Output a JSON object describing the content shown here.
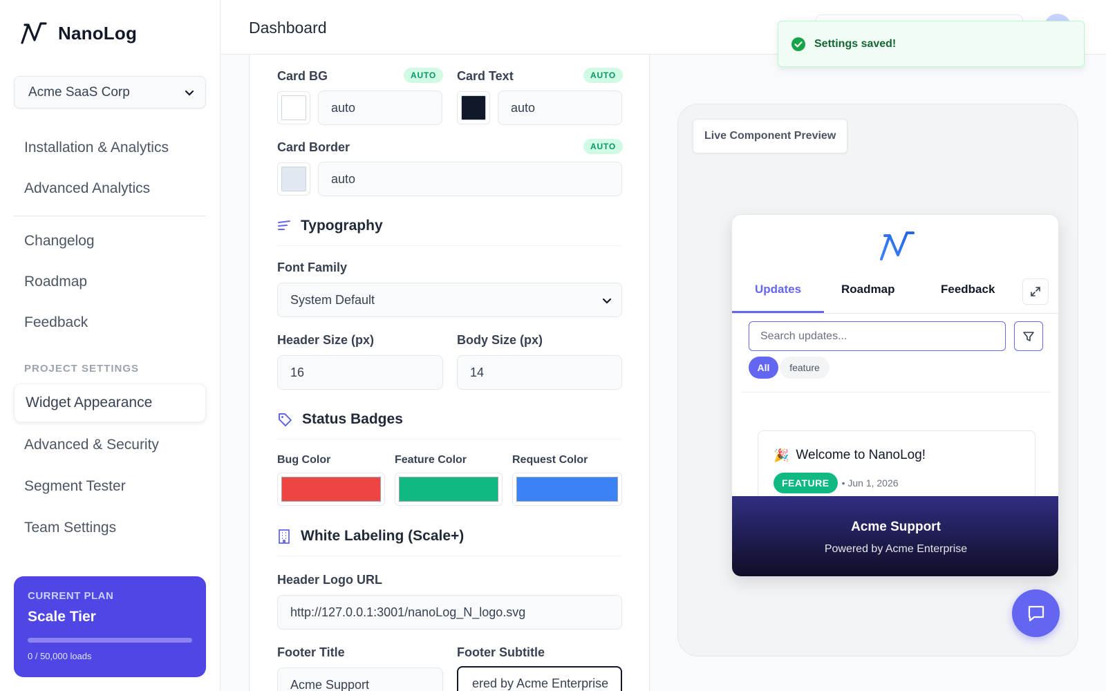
{
  "app": {
    "name": "NanoLog"
  },
  "sidebar": {
    "org": "Acme SaaS Corp",
    "items_top": [
      "Installation & Analytics",
      "Advanced Analytics"
    ],
    "items_content": [
      "Changelog",
      "Roadmap",
      "Feedback"
    ],
    "section_label": "PROJECT SETTINGS",
    "active_item": "Widget Appearance",
    "items_settings": [
      "Advanced & Security",
      "Segment Tester",
      "Team Settings"
    ],
    "plan": {
      "label": "CURRENT PLAN",
      "name": "Scale Tier",
      "usage": "0 / 50,000 loads",
      "usage_fraction": 0
    }
  },
  "header": {
    "title": "Dashboard"
  },
  "toast": {
    "text": "Settings saved!"
  },
  "colors": {
    "card_bg": {
      "label": "Card BG",
      "badge": "AUTO",
      "value": "auto",
      "swatch": "#ffffff"
    },
    "card_text": {
      "label": "Card Text",
      "badge": "AUTO",
      "value": "auto",
      "swatch": "#111827"
    },
    "card_border": {
      "label": "Card Border",
      "badge": "AUTO",
      "value": "auto",
      "swatch": "#e2e8f0"
    }
  },
  "typography": {
    "title": "Typography",
    "font_family_label": "Font Family",
    "font_family": "System Default",
    "header_size_label": "Header Size (px)",
    "header_size": "16",
    "body_size_label": "Body Size (px)",
    "body_size": "14"
  },
  "badges": {
    "title": "Status Badges",
    "bug_label": "Bug Color",
    "bug_color": "#ef4444",
    "feature_label": "Feature Color",
    "feature_color": "#10b981",
    "request_label": "Request Color",
    "request_color": "#3b82f6"
  },
  "white_label": {
    "title": "White Labeling (Scale+)",
    "logo_url_label": "Header Logo URL",
    "logo_url": "http://127.0.0.1:3001/nanoLog_N_logo.svg",
    "footer_title_label": "Footer Title",
    "footer_title": "Acme Support",
    "footer_subtitle_label": "Footer Subtitle",
    "footer_subtitle": "ered by Acme Enterprise"
  },
  "preview": {
    "chip": "Live Component Preview",
    "tabs": [
      "Updates",
      "Roadmap",
      "Feedback"
    ],
    "search_placeholder": "Search updates...",
    "filters": [
      "All",
      "feature"
    ],
    "post": {
      "title": "Welcome to NanoLog!",
      "badge": "FEATURE",
      "date": "• Jun 1, 2026"
    },
    "footer_title": "Acme Support",
    "footer_subtitle": "Powered by Acme Enterprise"
  }
}
